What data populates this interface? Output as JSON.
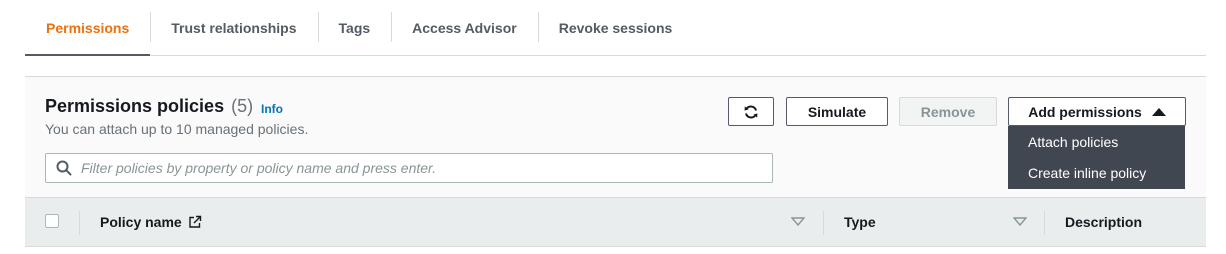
{
  "tabs": [
    {
      "label": "Permissions",
      "active": true
    },
    {
      "label": "Trust relationships",
      "active": false
    },
    {
      "label": "Tags",
      "active": false
    },
    {
      "label": "Access Advisor",
      "active": false
    },
    {
      "label": "Revoke sessions",
      "active": false
    }
  ],
  "panel": {
    "title": "Permissions policies",
    "count": "(5)",
    "info_link": "Info",
    "subtitle": "You can attach up to 10 managed policies.",
    "search": {
      "placeholder": "Filter policies by property or policy name and press enter.",
      "value": ""
    },
    "buttons": {
      "refresh_icon": "refresh-icon",
      "simulate": "Simulate",
      "remove": "Remove",
      "add_permissions": "Add permissions"
    },
    "dropdown": [
      "Attach policies",
      "Create inline policy"
    ],
    "table": {
      "columns": [
        "Policy name",
        "Type",
        "Description"
      ]
    }
  },
  "colors": {
    "active_tab": "#ec7211",
    "link": "#0073bb",
    "dropdown_bg": "#414750"
  }
}
